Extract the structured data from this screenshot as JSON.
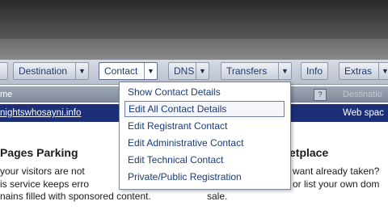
{
  "toolbar": {
    "buttons": [
      {
        "label": "Destination"
      },
      {
        "label": "Contact"
      },
      {
        "label": "DNS"
      },
      {
        "label": "Transfers"
      },
      {
        "label": "Info"
      },
      {
        "label": "Extras"
      }
    ],
    "arrow_glyph": "▼"
  },
  "table": {
    "header_left": "me",
    "help_glyph": "?",
    "header_right": "Destinatio",
    "row": {
      "domain": "nightswhosayni.info",
      "destination": "Web spac"
    }
  },
  "content": {
    "left_heading": "Pages Parking",
    "left_line1": "your visitors are not",
    "left_line2": "is service keeps erro",
    "left_line3": "nains filled with sponsored content.",
    "right_heading": "etplace",
    "right_line1": "want already taken?",
    "right_line2": "or list your own dom",
    "right_line3": "sale."
  },
  "contact_menu": {
    "items": [
      {
        "label": "Show Contact Details"
      },
      {
        "label": "Edit All Contact Details"
      },
      {
        "label": "Edit Registrant Contact"
      },
      {
        "label": "Edit Administrative Contact"
      },
      {
        "label": "Edit Technical Contact"
      },
      {
        "label": "Private/Public Registration"
      }
    ],
    "highlighted_index": 1
  },
  "colors": {
    "selected_row": "#1d2f78",
    "link_text": "#1f3a6e"
  }
}
